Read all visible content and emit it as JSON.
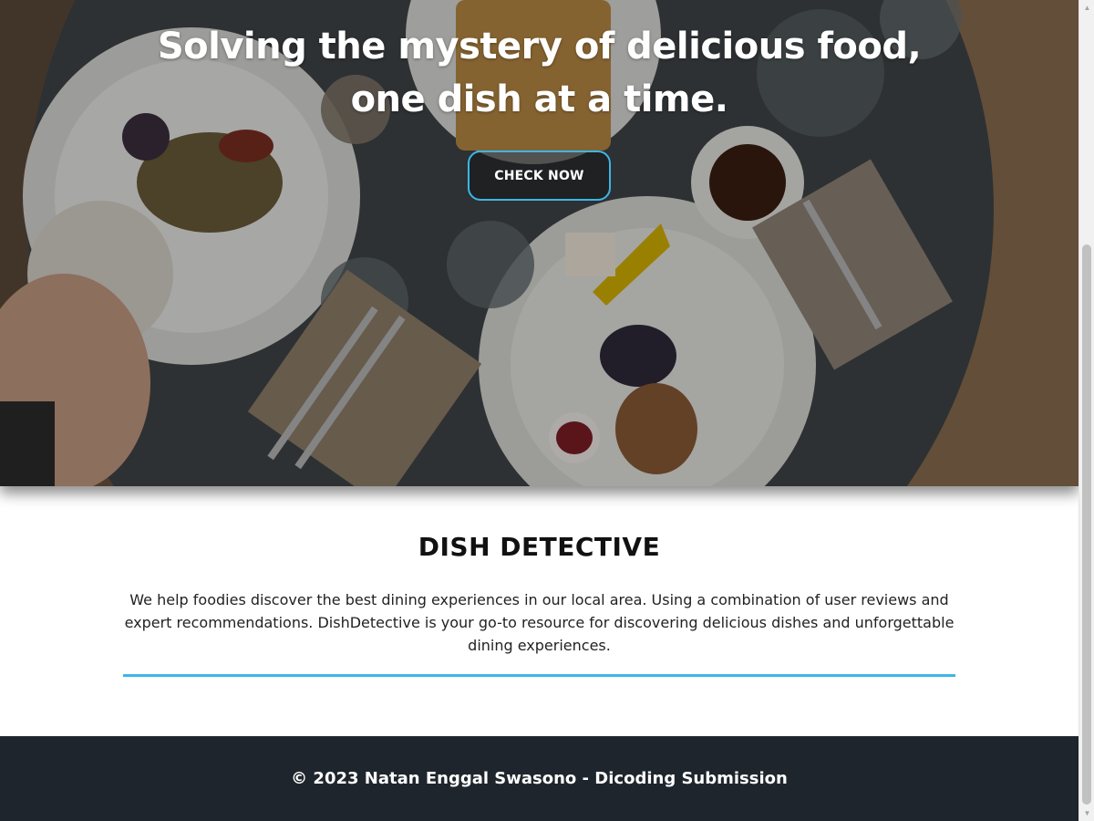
{
  "hero": {
    "title_line1": "Solving the mystery of delicious food,",
    "title_line2": "one dish at a time.",
    "cta_label": "CHECK NOW",
    "accent_color": "#3db6e6"
  },
  "about": {
    "title": "DISH DETECTIVE",
    "description": "We help foodies discover the best dining experiences in our local area. Using a combination of user reviews and expert recommendations. DishDetective is your go-to resource for discovering delicious dishes and unforgettable dining experiences."
  },
  "footer": {
    "text": "© 2023 Natan Enggal Swasono - Dicoding Submission",
    "background_color": "#1f252c"
  },
  "scrollbar": {
    "up_icon": "triangle-up-icon",
    "down_icon": "triangle-down-icon"
  }
}
